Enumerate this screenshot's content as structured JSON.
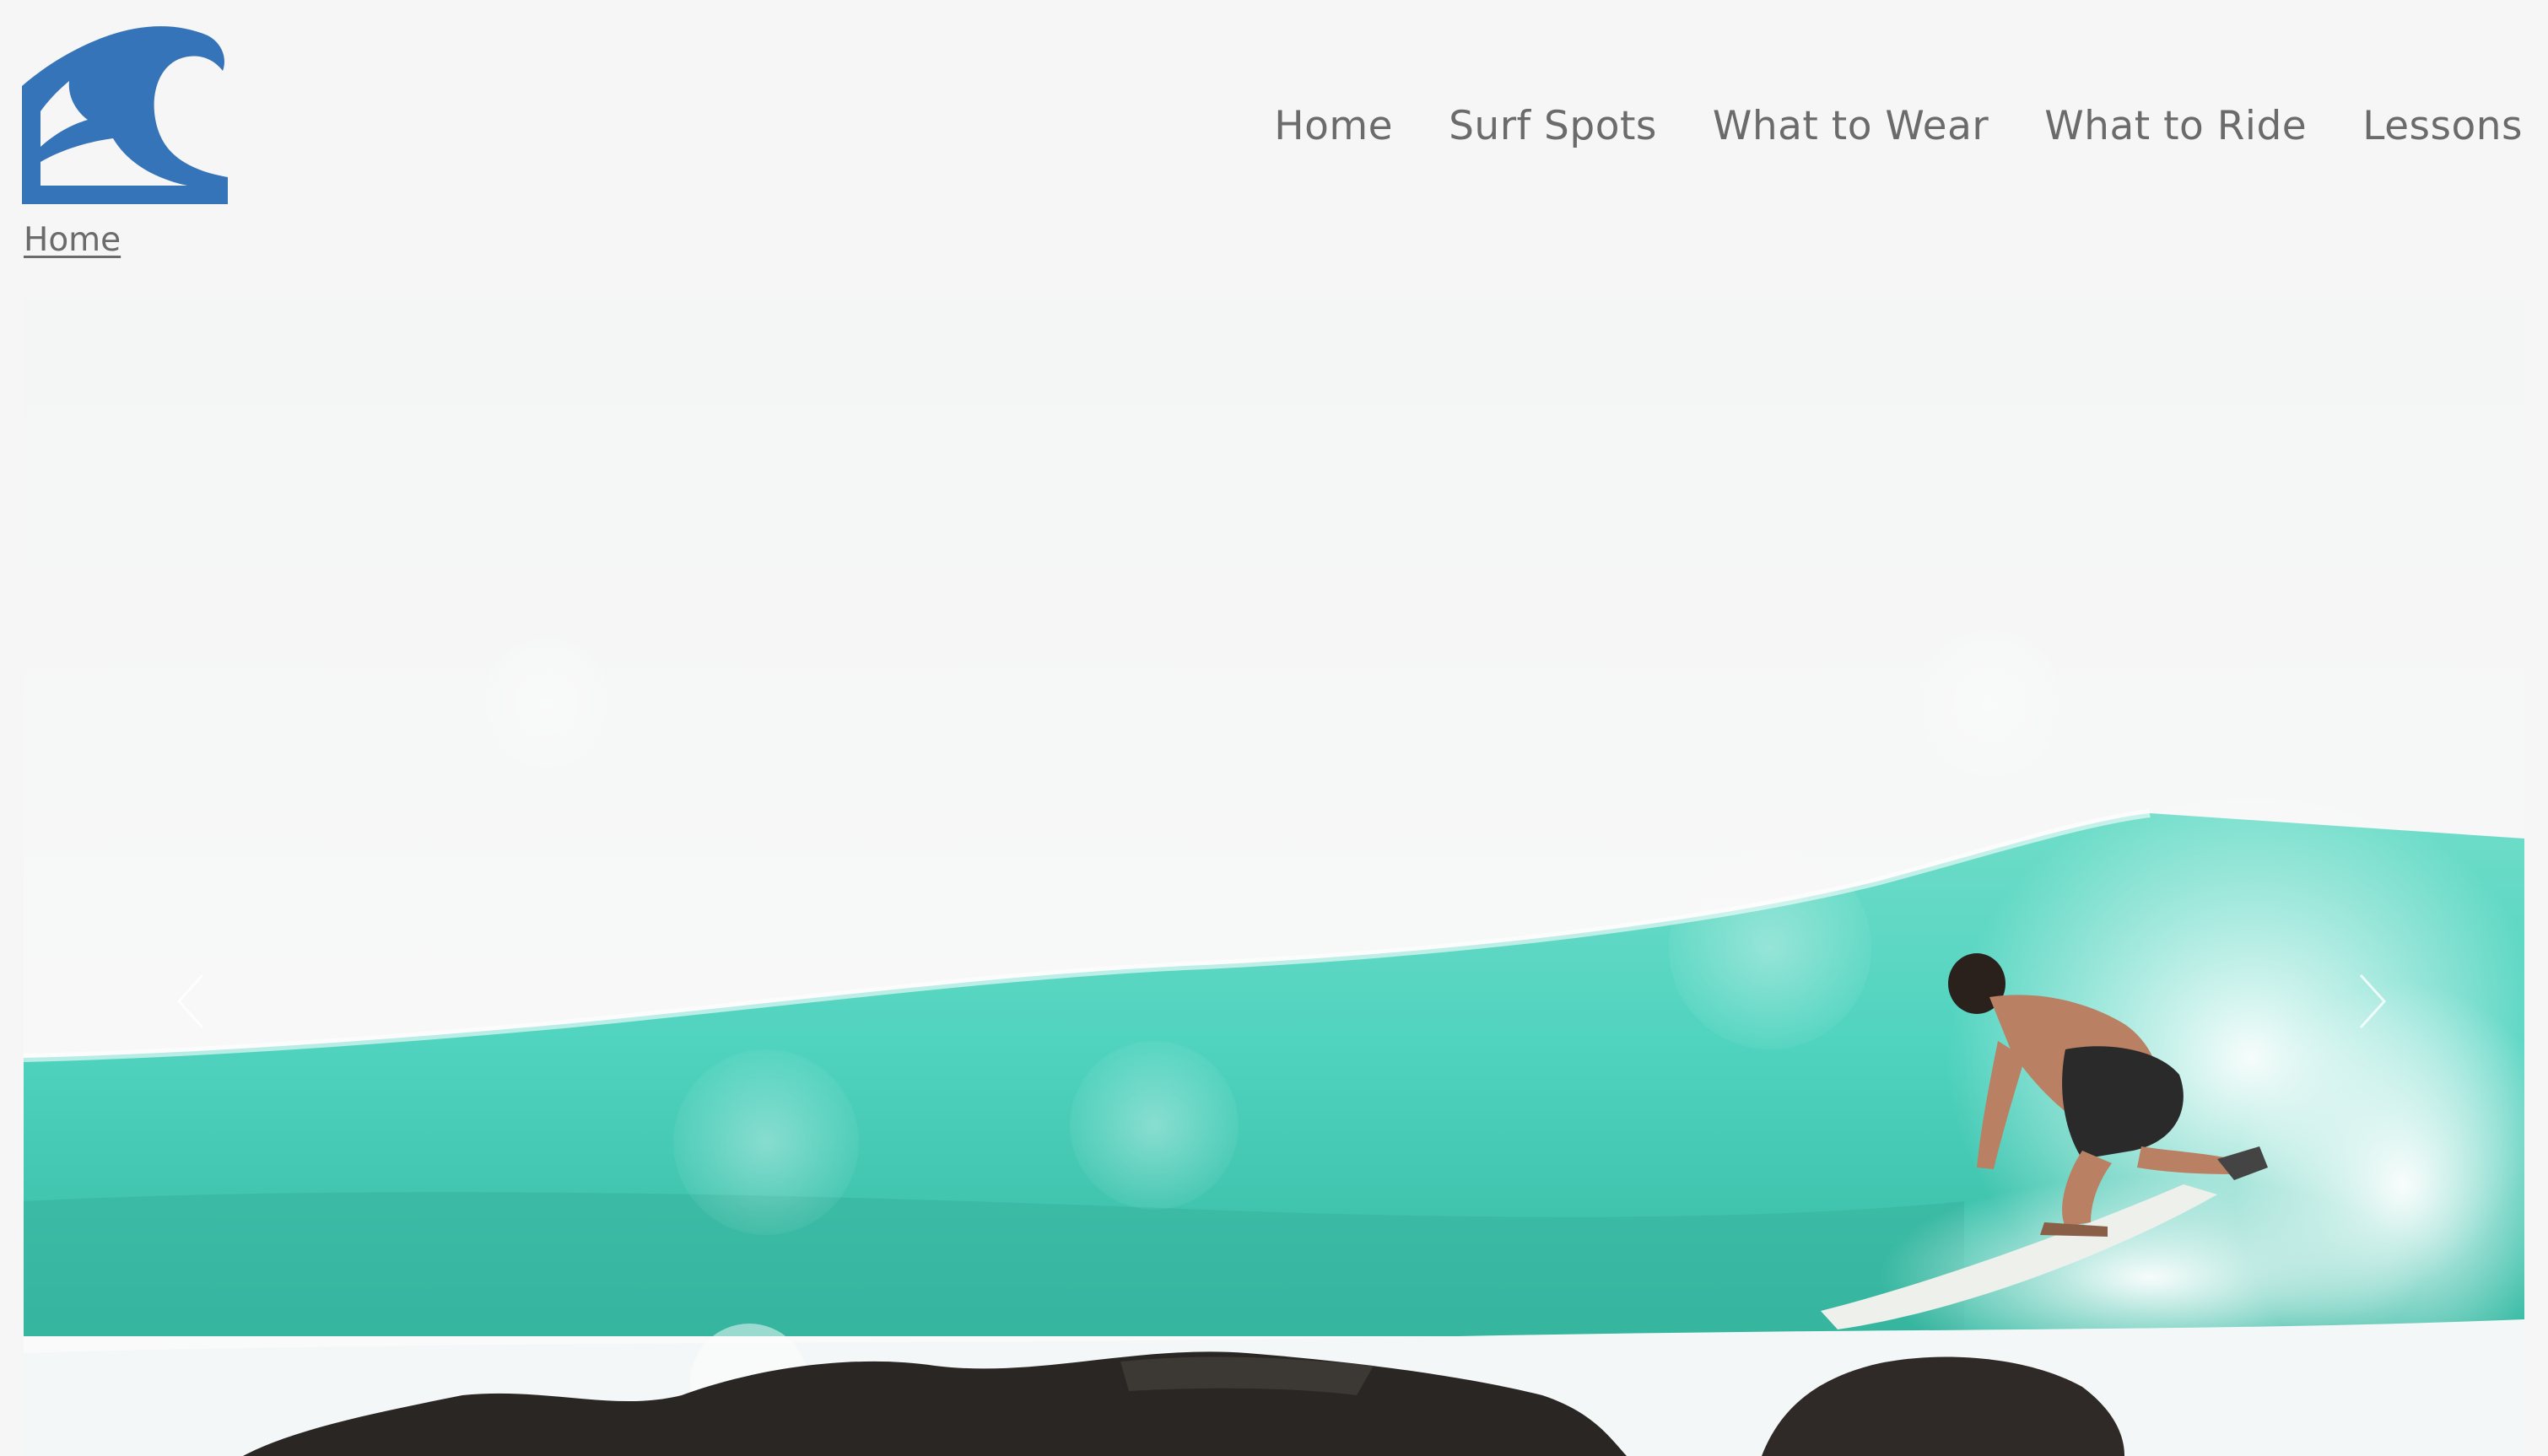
{
  "logo": {
    "icon": "wave-logo-icon",
    "color": "#3574b9"
  },
  "nav": {
    "items": [
      {
        "label": "Home"
      },
      {
        "label": "Surf Spots"
      },
      {
        "label": "What to Wear"
      },
      {
        "label": "What to Ride"
      },
      {
        "label": "Lessons"
      }
    ]
  },
  "breadcrumb": {
    "current": "Home"
  },
  "hero": {
    "image": "surfer-riding-wave-photo",
    "carousel": {
      "prev_icon": "chevron-left-icon",
      "next_icon": "chevron-right-icon"
    },
    "colors": {
      "sky": "#f5f6f6",
      "wave": "#4fd3bf",
      "wave_deep": "#2fa892",
      "rocks": "#2a2624"
    }
  }
}
